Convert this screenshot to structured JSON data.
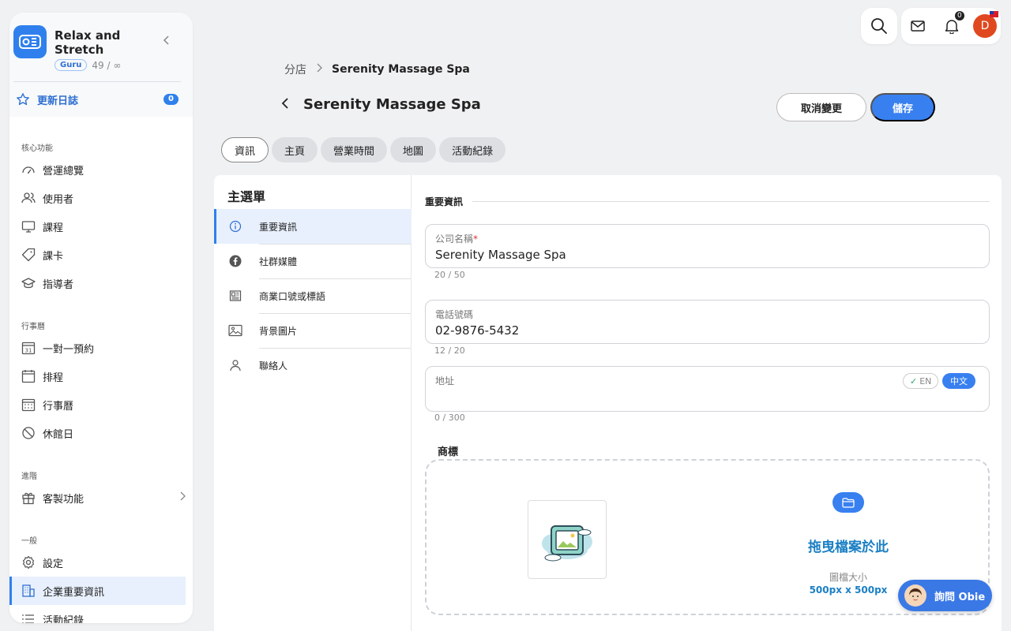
{
  "workspace": {
    "name": "Relax and Stretch",
    "plan_badge": "Guru",
    "usage": "49 / ∞",
    "changelog_label": "更新日誌",
    "changelog_count": "0"
  },
  "sidebar": {
    "sections": [
      {
        "title": "核心功能",
        "items": [
          {
            "label": "營運總覽",
            "icon": "dashboard-icon"
          },
          {
            "label": "使用者",
            "icon": "users-icon"
          },
          {
            "label": "課程",
            "icon": "monitor-icon"
          },
          {
            "label": "課卡",
            "icon": "ticket-icon"
          },
          {
            "label": "指導者",
            "icon": "graduation-cap-icon"
          }
        ]
      },
      {
        "title": "行事曆",
        "items": [
          {
            "label": "一對一預約",
            "icon": "calendar-31-icon"
          },
          {
            "label": "排程",
            "icon": "calendar-icon"
          },
          {
            "label": "行事曆",
            "icon": "calendar-grid-icon"
          },
          {
            "label": "休館日",
            "icon": "ban-icon"
          }
        ]
      },
      {
        "title": "進階",
        "items": [
          {
            "label": "客製功能",
            "icon": "gift-icon"
          }
        ]
      },
      {
        "title": "一般",
        "items": [
          {
            "label": "設定",
            "icon": "gear-icon"
          },
          {
            "label": "企業重要資訊",
            "icon": "building-icon",
            "active": true
          },
          {
            "label": "活動紀錄",
            "icon": "list-icon"
          }
        ]
      }
    ]
  },
  "topbar": {
    "notification_count": "0",
    "avatar_initial": "D"
  },
  "breadcrumb": {
    "parent": "分店",
    "current": "Serenity Massage Spa"
  },
  "page": {
    "title": "Serenity Massage Spa",
    "cancel_label": "取消變更",
    "save_label": "儲存"
  },
  "tabs": [
    {
      "label": "資訊",
      "active": true
    },
    {
      "label": "主頁"
    },
    {
      "label": "營業時間"
    },
    {
      "label": "地圖"
    },
    {
      "label": "活動紀錄"
    }
  ],
  "submenu": {
    "title": "主選單",
    "items": [
      {
        "label": "重要資訊",
        "icon": "info-icon",
        "active": true
      },
      {
        "label": "社群媒體",
        "icon": "facebook-icon"
      },
      {
        "label": "商業口號或標語",
        "icon": "newspaper-icon"
      },
      {
        "label": "背景圖片",
        "icon": "image-icon"
      },
      {
        "label": "聯絡人",
        "icon": "person-icon"
      }
    ]
  },
  "form": {
    "section_title": "重要資訊",
    "company_name": {
      "label": "公司名稱",
      "required_mark": "*",
      "value": "Serenity Massage Spa",
      "counter": "20 / 50"
    },
    "phone": {
      "label": "電話號碼",
      "value": "02-9876-5432",
      "counter": "12 / 20"
    },
    "address": {
      "label": "地址",
      "value": "",
      "counter": "0 / 300",
      "lang_en": "EN",
      "lang_en_check": "✓",
      "lang_zh": "中文"
    },
    "logo": {
      "label": "商標",
      "drop_text": "拖曳檔案於此",
      "size_label": "圖檔大小",
      "size_value": "500px x 500px"
    }
  },
  "assistant": {
    "label": "詢問 Obie"
  },
  "colors": {
    "accent": "#3880f0",
    "link": "#1a7fc4",
    "active_bg": "#e8f0fd",
    "avatar": "#e0491f"
  }
}
